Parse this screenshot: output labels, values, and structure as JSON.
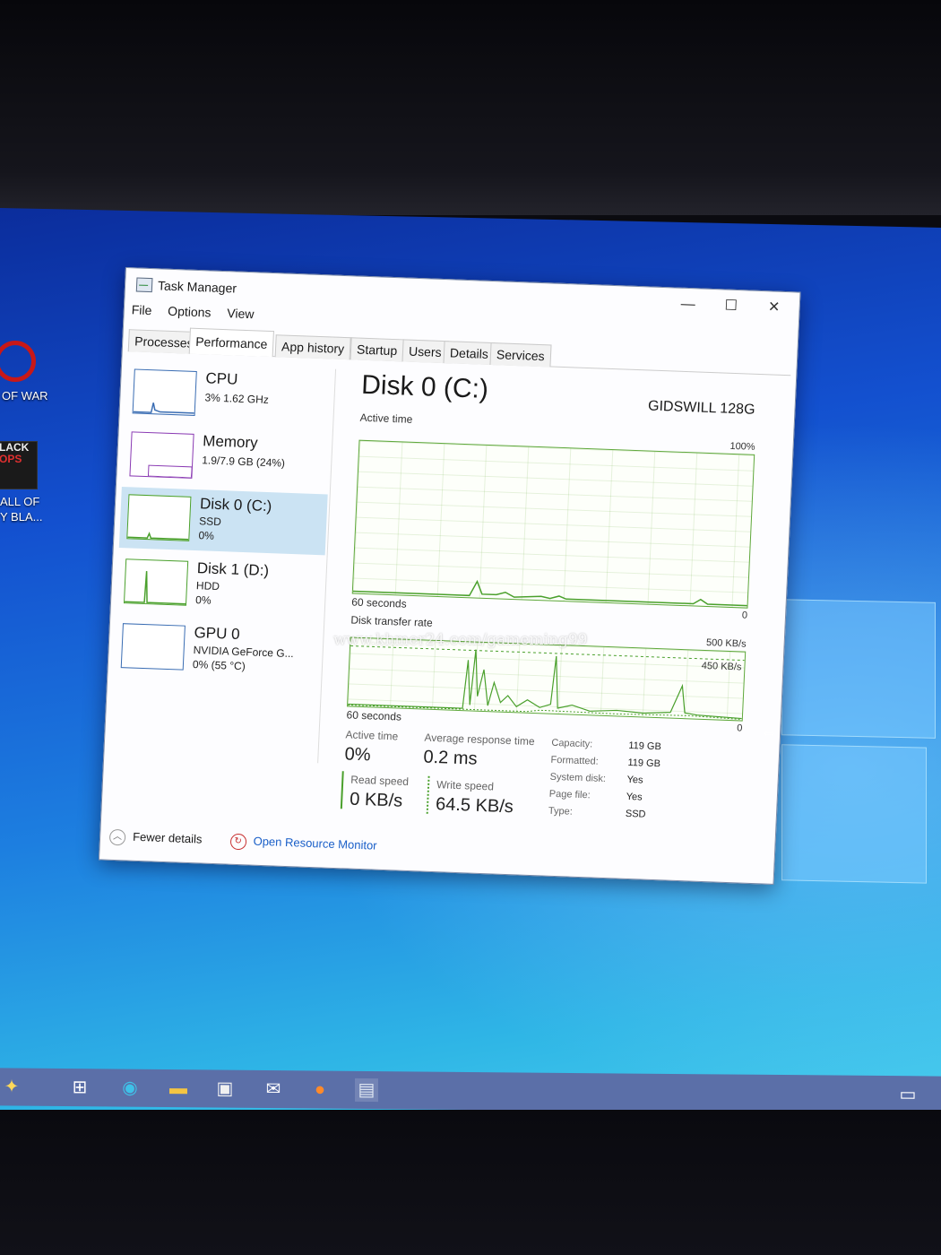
{
  "desktop": {
    "icons": [
      {
        "label": "OF WAR"
      },
      {
        "label_line1": "ALL OF",
        "label_line2": "Y BLA...",
        "tile_a": "LACK",
        "tile_b": "OPS"
      }
    ]
  },
  "window": {
    "title": "Task Manager",
    "menu": [
      "File",
      "Options",
      "View"
    ],
    "controls": {
      "minimize": "—",
      "maximize": "☐",
      "close": "✕"
    },
    "tabs": [
      "Processes",
      "Performance",
      "App history",
      "Startup",
      "Users",
      "Details",
      "Services"
    ],
    "active_tab": "Performance"
  },
  "sidebar": {
    "items": [
      {
        "name": "CPU",
        "line1": "3%  1.62 GHz",
        "line2": ""
      },
      {
        "name": "Memory",
        "line1": "1.9/7.9 GB (24%)",
        "line2": ""
      },
      {
        "name": "Disk 0 (C:)",
        "line1": "SSD",
        "line2": "0%"
      },
      {
        "name": "Disk 1 (D:)",
        "line1": "HDD",
        "line2": "0%"
      },
      {
        "name": "GPU 0",
        "line1": "NVIDIA GeForce G...",
        "line2": "0%  (55 °C)"
      }
    ],
    "selected_index": 2
  },
  "main": {
    "title": "Disk 0 (C:)",
    "model": "GIDSWILL 128G",
    "active_time_graph": {
      "label": "Active time",
      "max_label": "100%",
      "min_label": "0",
      "time_label": "60 seconds"
    },
    "transfer_graph": {
      "label": "Disk transfer rate",
      "max_label": "500 KB/s",
      "mid_label": "450 KB/s",
      "min_label": "0",
      "time_label": "60 seconds"
    },
    "stats": {
      "active_time_label": "Active time",
      "active_time_value": "0%",
      "avg_response_label": "Average response time",
      "avg_response_value": "0.2 ms",
      "read_speed_label": "Read speed",
      "read_speed_value": "0 KB/s",
      "write_speed_label": "Write speed",
      "write_speed_value": "64.5 KB/s"
    },
    "properties": [
      {
        "key": "Capacity:",
        "value": "119 GB"
      },
      {
        "key": "Formatted:",
        "value": "119 GB"
      },
      {
        "key": "System disk:",
        "value": "Yes"
      },
      {
        "key": "Page file:",
        "value": "Yes"
      },
      {
        "key": "Type:",
        "value": "SSD"
      }
    ]
  },
  "footer": {
    "fewer_details": "Fewer details",
    "open_resource_monitor": "Open Resource Monitor"
  },
  "watermark": "www.khmer24.com/gameming99",
  "taskbar": {
    "icons": [
      "start-icon",
      "task-view-icon",
      "edge-icon",
      "file-explorer-icon",
      "store-icon",
      "mail-icon",
      "firefox-icon",
      "task-manager-icon",
      "notifications-icon"
    ]
  },
  "colors": {
    "accent_disk": "#4aa02c",
    "accent_cpu": "#3a6db3",
    "selection": "#cbe3f3",
    "link": "#1a5fc8"
  }
}
